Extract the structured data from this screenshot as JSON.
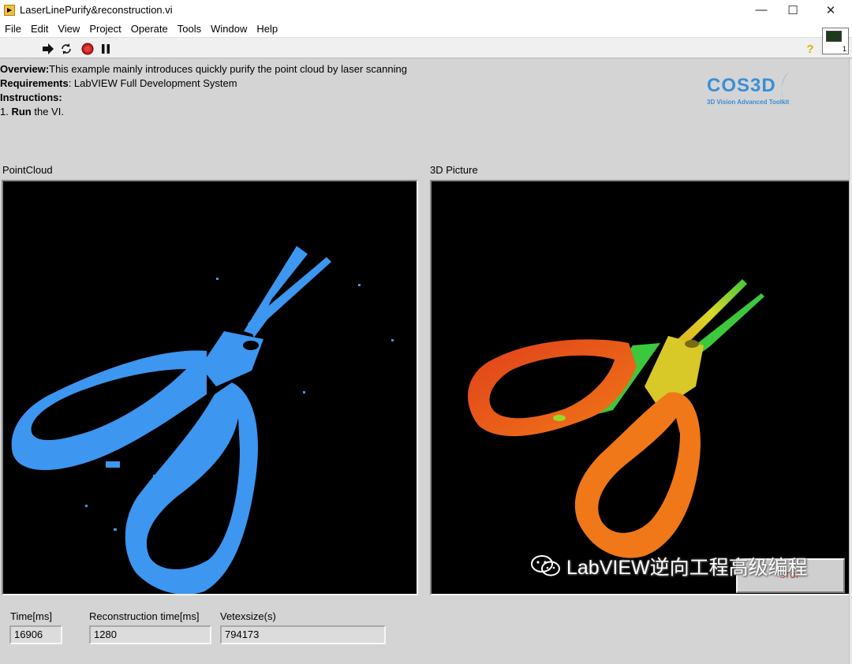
{
  "window": {
    "title": "LaserLinePurify&reconstruction.vi",
    "min": "—",
    "max": "☐",
    "close": "✕"
  },
  "menu": [
    "File",
    "Edit",
    "View",
    "Project",
    "Operate",
    "Tools",
    "Window",
    "Help"
  ],
  "toolbar": {
    "help": "?",
    "vi_icon_number": "1"
  },
  "overview": {
    "overview_label": "Overview:",
    "overview_text": "This example mainly introduces  quickly purify the point cloud by laser scanning",
    "requirements_label": "Requirements",
    "requirements_text": ": LabVIEW Full Development System",
    "instructions_label": "Instructions:",
    "step_prefix": "1. ",
    "step_bold": "Run",
    "step_text": " the VI."
  },
  "logo": {
    "word": "COS3D",
    "tagline": "3D Vision Advanced Toolkit"
  },
  "displays": {
    "pointcloud_label": "PointCloud",
    "picture_label": "3D Picture"
  },
  "indicators": {
    "time_label": "Time[ms]",
    "time_value": "16906",
    "recon_label": "Reconstruction time[ms]",
    "recon_value": "1280",
    "vertex_label": "Vetexsize(s)",
    "vertex_value": "794173"
  },
  "stop_button": "STOP",
  "watermark": "LabVIEW逆向工程高级编程",
  "colors": {
    "pointcloud": "#3d96f0",
    "handle_red": "#e0401a",
    "handle_orange": "#f07818",
    "blade_yellow": "#d8d828",
    "blade_green": "#3cc83c"
  }
}
